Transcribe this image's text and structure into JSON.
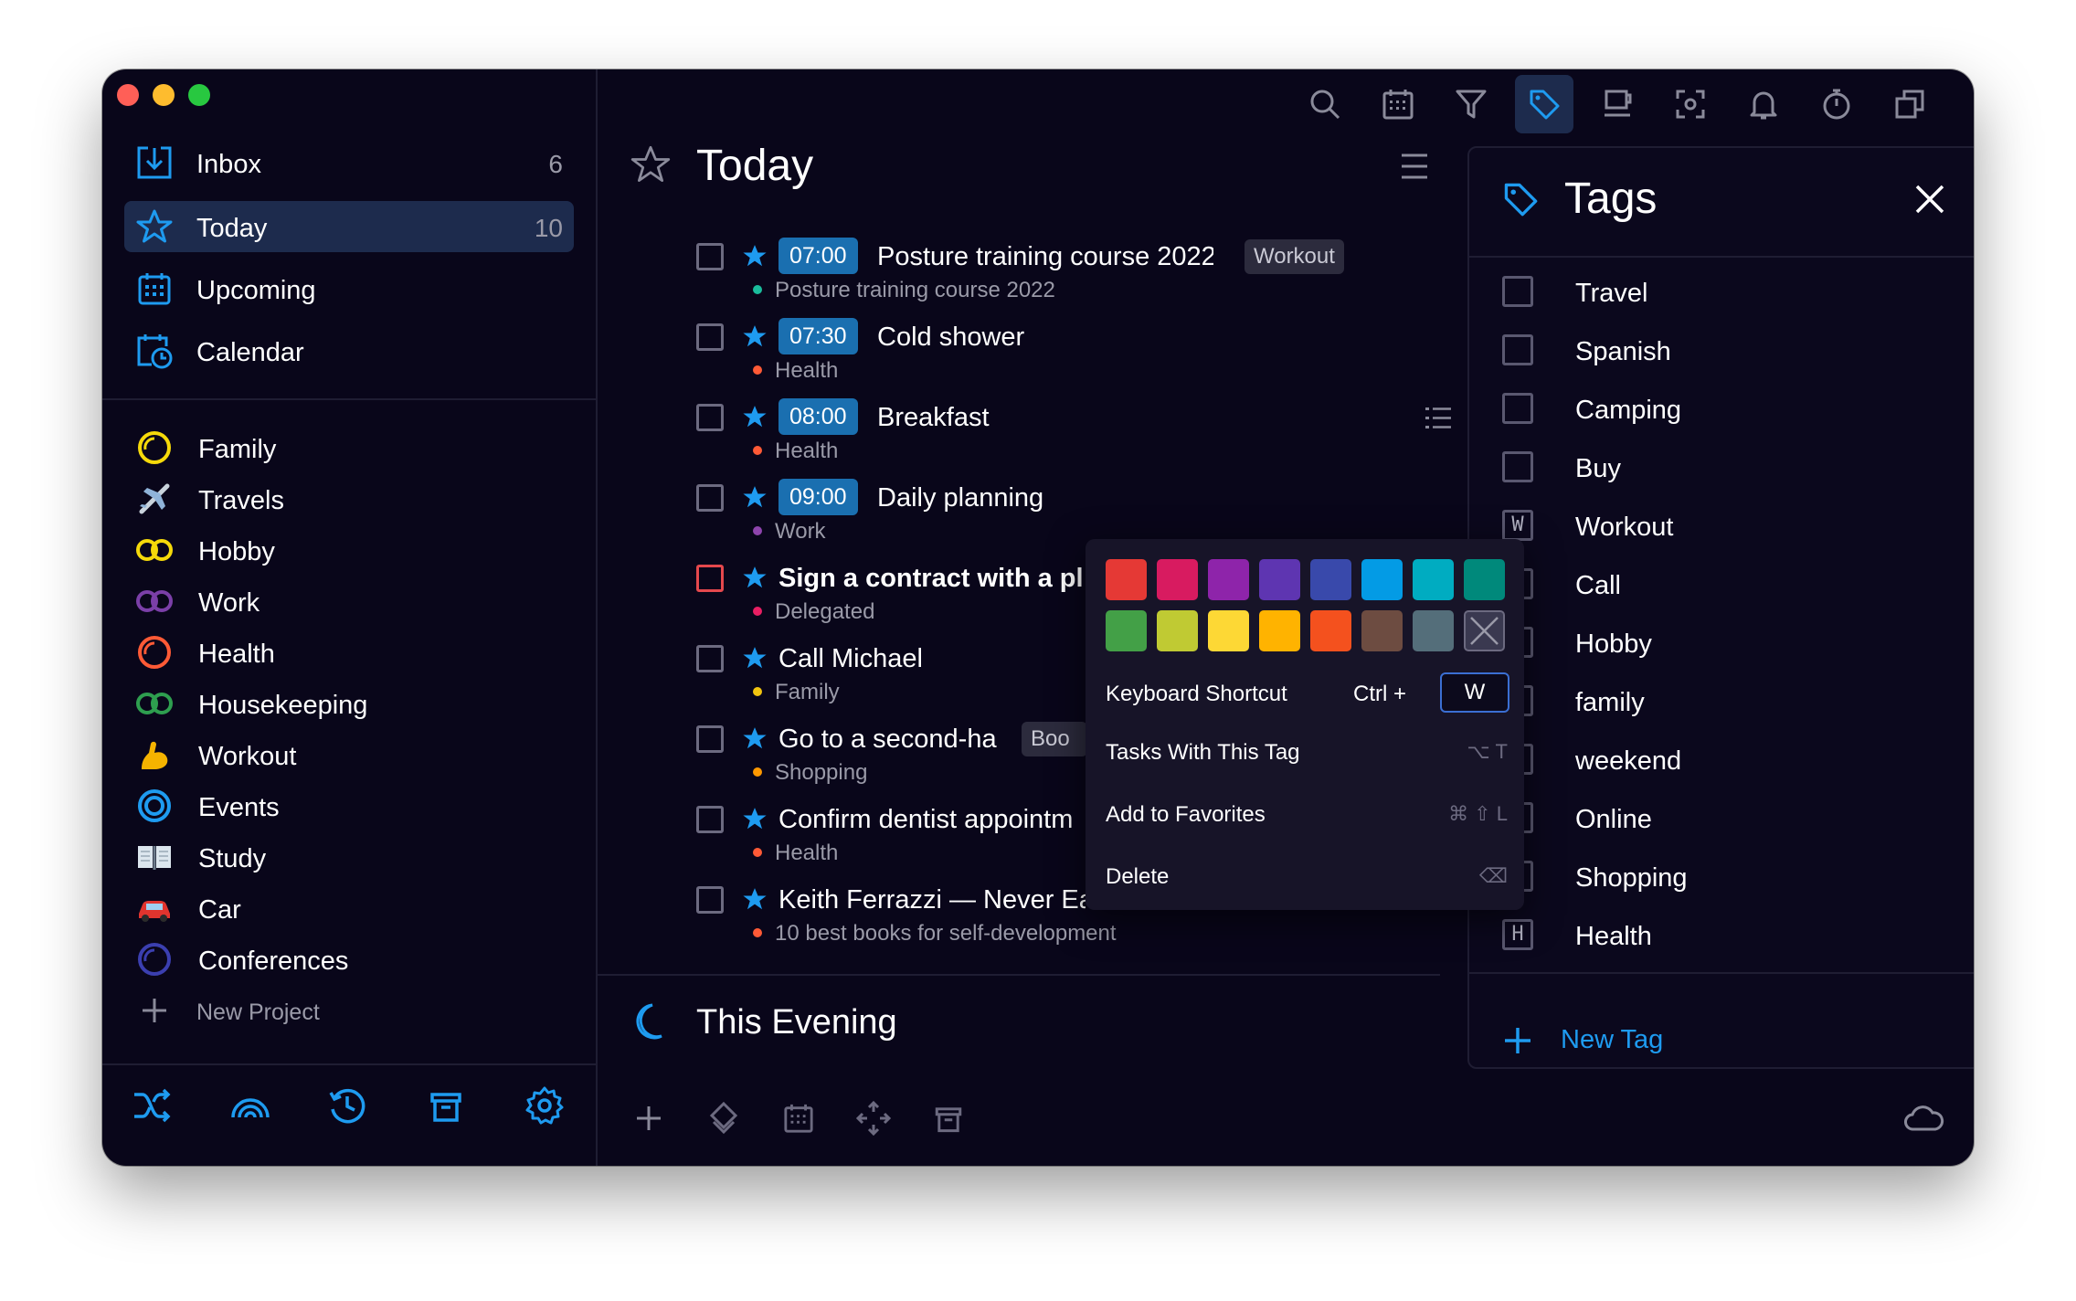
{
  "colors": {
    "accent": "#1e9bf0",
    "window_bg": "#09061a",
    "active_row": "#1d2b4d",
    "time_badge": "#1a6fb0"
  },
  "sidebar": {
    "nav": [
      {
        "label": "Inbox",
        "count": "6",
        "icon": "inbox-icon"
      },
      {
        "label": "Today",
        "count": "10",
        "icon": "star-icon",
        "active": true
      },
      {
        "label": "Upcoming",
        "count": "",
        "icon": "calendar-grid-icon"
      },
      {
        "label": "Calendar",
        "count": "",
        "icon": "calendar-clock-icon"
      }
    ],
    "projects": [
      {
        "label": "Family",
        "icon": "ring-yellow-icon"
      },
      {
        "label": "Travels",
        "icon": "airplane-icon"
      },
      {
        "label": "Hobby",
        "icon": "double-ring-yellow-icon"
      },
      {
        "label": "Work",
        "icon": "double-ring-purple-icon"
      },
      {
        "label": "Health",
        "icon": "ring-orange-icon"
      },
      {
        "label": "Housekeeping",
        "icon": "double-ring-green-icon"
      },
      {
        "label": "Workout",
        "icon": "flexed-biceps-icon"
      },
      {
        "label": "Events",
        "icon": "ring-blue-icon"
      },
      {
        "label": "Study",
        "icon": "open-book-icon"
      },
      {
        "label": "Car",
        "icon": "car-icon"
      },
      {
        "label": "Conferences",
        "icon": "ring-indigo-icon"
      }
    ],
    "new_project": "New Project",
    "bottom_icons": [
      "shuffle-icon",
      "rainbow-icon",
      "history-icon",
      "trash-icon",
      "settings-icon"
    ]
  },
  "main": {
    "title": "Today",
    "toolbar": [
      "search-icon",
      "calendar-icon",
      "filter-icon",
      "tag-icon",
      "coffee-icon",
      "focus-icon",
      "bell-icon",
      "timer-icon",
      "copy-icon"
    ],
    "tasks": [
      {
        "time": "07:00",
        "title": "Posture training course 2022",
        "sub": "Posture training course 2022",
        "sub_color": "#1abc9c",
        "chip": "Workout"
      },
      {
        "time": "07:30",
        "title": "Cold shower",
        "sub": "Health",
        "sub_color": "#ff5a36"
      },
      {
        "time": "08:00",
        "title": "Breakfast",
        "sub": "Health",
        "sub_color": "#ff5a36"
      },
      {
        "time": "09:00",
        "title": "Daily planning",
        "sub": "Work",
        "sub_color": "#8e44ad"
      },
      {
        "time": "",
        "title": "Sign a contract with a pl",
        "sub": "Delegated",
        "sub_color": "#e91e63"
      },
      {
        "time": "",
        "title": "Call Michael",
        "sub": "Family",
        "sub_color": "#f1c40f"
      },
      {
        "time": "",
        "title": "Go to a second-ha",
        "sub": "Shopping",
        "sub_color": "#ff9800",
        "chip": "Boo"
      },
      {
        "time": "",
        "title": "Confirm dentist appointm",
        "sub": "Health",
        "sub_color": "#ff5a36"
      },
      {
        "time": "",
        "title": "Keith Ferrazzi — Never Ea",
        "sub": "10 best books for self-development",
        "sub_color": "#ff5a36"
      }
    ],
    "evening_title": "This Evening",
    "bottom_tools": [
      "plus-icon",
      "priority-icon",
      "calendar-icon",
      "move-icon",
      "trash-icon"
    ]
  },
  "popup": {
    "swatches": [
      "#e53935",
      "#d81b60",
      "#8e24aa",
      "#5e35b1",
      "#3949ab",
      "#039be5",
      "#00acc1",
      "#00897b",
      "#43a047",
      "#c0ca33",
      "#fdd835",
      "#ffb300",
      "#f4511e",
      "#6d4c41",
      "#546e7a",
      "#none"
    ],
    "shortcut_label": "Keyboard Shortcut",
    "shortcut_mod": "Ctrl +",
    "shortcut_key": "W",
    "tasks_with_tag": "Tasks With This Tag",
    "tasks_with_tag_shortcut": "⌥ T",
    "add_favorites": "Add to Favorites",
    "add_favorites_shortcut": "⌘ ⇧ L",
    "delete": "Delete",
    "delete_shortcut": "⌫"
  },
  "tags": {
    "title": "Tags",
    "items": [
      {
        "label": "Travel",
        "key": ""
      },
      {
        "label": "Spanish",
        "key": ""
      },
      {
        "label": "Camping",
        "key": ""
      },
      {
        "label": "Buy",
        "key": ""
      },
      {
        "label": "Workout",
        "key": "W"
      },
      {
        "label": "Call",
        "key": ""
      },
      {
        "label": "Hobby",
        "key": ""
      },
      {
        "label": "family",
        "key": ""
      },
      {
        "label": "weekend",
        "key": ""
      },
      {
        "label": "Online",
        "key": ""
      },
      {
        "label": "Shopping",
        "key": ""
      },
      {
        "label": "Health",
        "key": "H"
      }
    ],
    "new_tag": "New Tag"
  }
}
